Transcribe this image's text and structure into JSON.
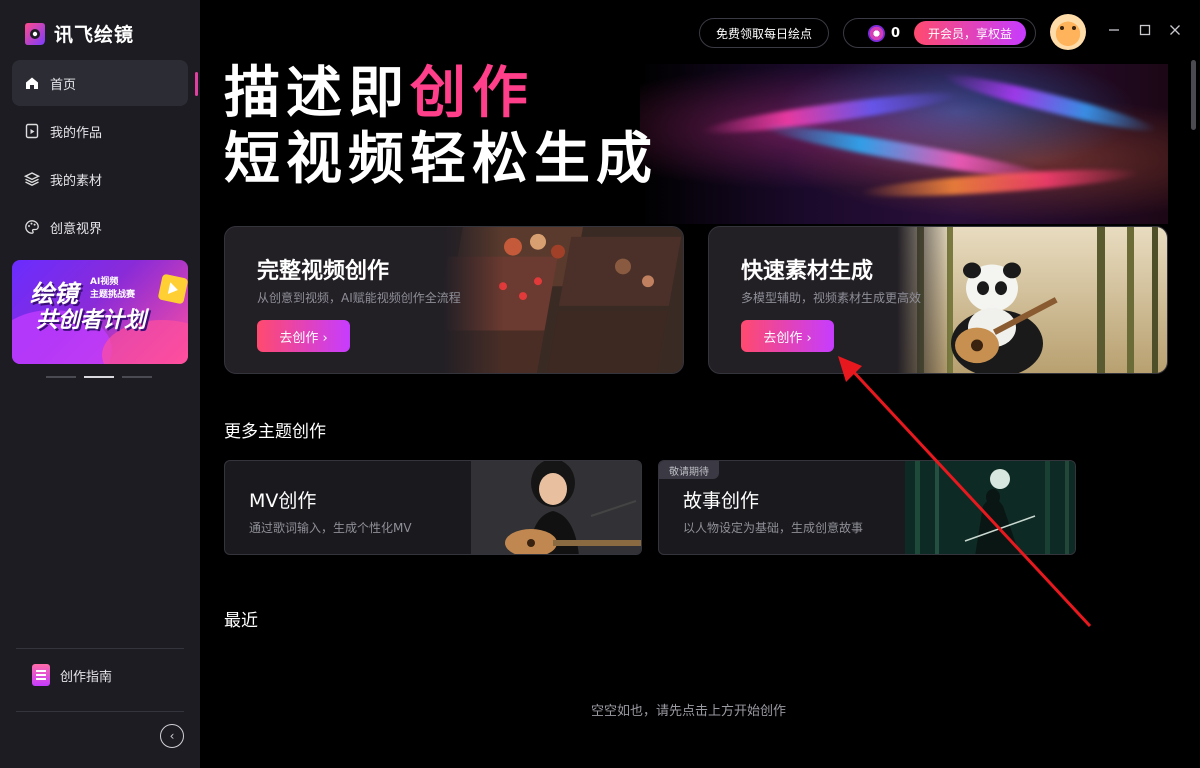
{
  "app": {
    "name": "讯飞绘镜"
  },
  "sidebar": {
    "items": [
      {
        "label": "首页",
        "icon": "home-icon",
        "active": true
      },
      {
        "label": "我的作品",
        "icon": "works-icon",
        "active": false
      },
      {
        "label": "我的素材",
        "icon": "layers-icon",
        "active": false
      },
      {
        "label": "创意视界",
        "icon": "palette-icon",
        "active": false
      }
    ],
    "promo": {
      "line1": "绘镜",
      "line2": "共创者计划",
      "tag1": "AI视频",
      "tag2": "主题挑战赛"
    },
    "carousel": {
      "count": 3,
      "active_index": 1
    },
    "guide_label": "创作指南"
  },
  "topbar": {
    "free_points_label": "免费领取每日绘点",
    "points_count": "0",
    "vip_label": "开会员，享权益"
  },
  "hero": {
    "line1_prefix": "描述即",
    "line1_highlight": "创作",
    "line2": "短视频轻松生成"
  },
  "feature_cards": [
    {
      "title": "完整视频创作",
      "desc": "从创意到视频，AI赋能视频创作全流程",
      "button": "去创作 ›"
    },
    {
      "title": "快速素材生成",
      "desc": "多模型辅助，视频素材生成更高效",
      "button": "去创作 ›"
    }
  ],
  "more_themes": {
    "title": "更多主题创作",
    "cards": [
      {
        "title": "MV创作",
        "desc": "通过歌词输入，生成个性化MV",
        "tag": ""
      },
      {
        "title": "故事创作",
        "desc": "以人物设定为基础，生成创意故事",
        "tag": "敬请期待"
      }
    ]
  },
  "recent": {
    "title": "最近",
    "empty_text": "空空如也，请先点击上方开始创作"
  },
  "colors": {
    "accent_gradient_start": "#ff4a6e",
    "accent_gradient_end": "#c63cff",
    "sidebar_bg": "#1c1c22",
    "annotation_arrow": "#e8191e"
  }
}
